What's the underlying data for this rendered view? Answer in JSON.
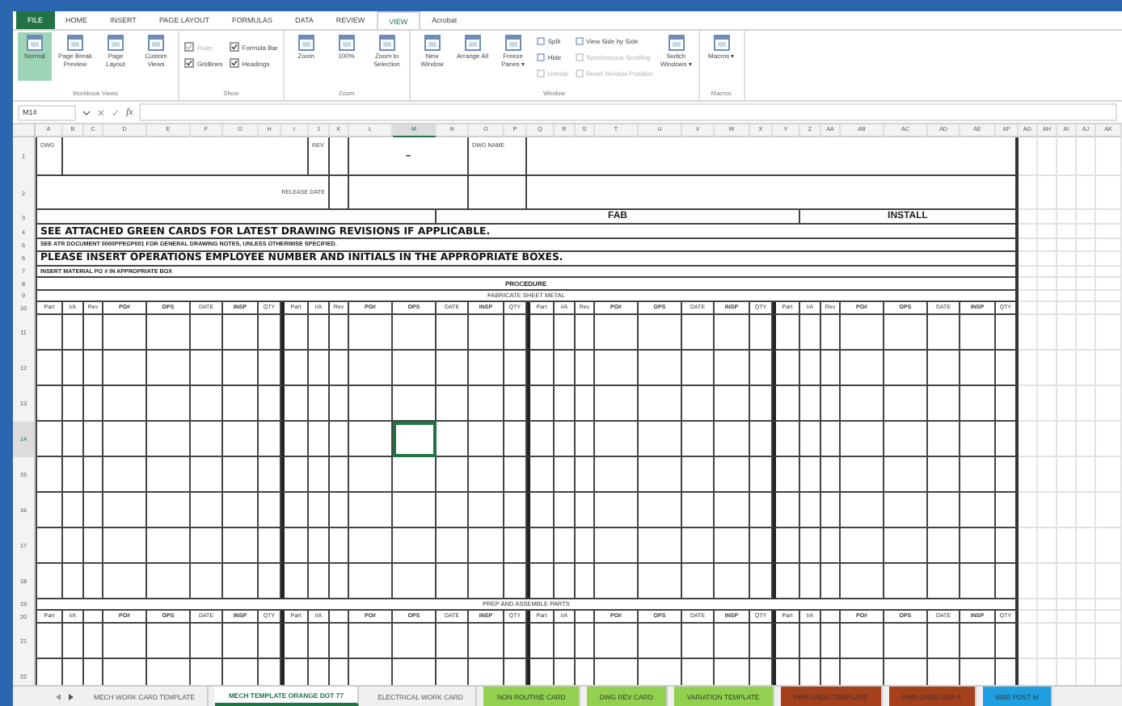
{
  "ribbon_tabs": [
    {
      "label": "FILE",
      "kind": "file",
      "selected": false
    },
    {
      "label": "HOME",
      "kind": "tab",
      "selected": false
    },
    {
      "label": "INSERT",
      "kind": "tab",
      "selected": false
    },
    {
      "label": "PAGE LAYOUT",
      "kind": "tab",
      "selected": false
    },
    {
      "label": "FORMULAS",
      "kind": "tab",
      "selected": false
    },
    {
      "label": "DATA",
      "kind": "tab",
      "selected": false
    },
    {
      "label": "REVIEW",
      "kind": "tab",
      "selected": false
    },
    {
      "label": "VIEW",
      "kind": "tab",
      "selected": true
    },
    {
      "label": "Acrobat",
      "kind": "tab",
      "selected": false
    }
  ],
  "ribbon_groups": [
    {
      "label": "Workbook Views",
      "items": [
        {
          "kind": "toggle",
          "label": "Normal",
          "selected": true
        },
        {
          "kind": "toggle",
          "label": "Page Break Preview",
          "selected": false
        },
        {
          "kind": "toggle",
          "label": "Page Layout",
          "selected": false
        },
        {
          "kind": "toggle",
          "label": "Custom Views",
          "selected": false
        }
      ]
    },
    {
      "label": "Show",
      "items": [
        {
          "kind": "check",
          "label": "Ruler",
          "checked": true,
          "disabled": true
        },
        {
          "kind": "check",
          "label": "Gridlines",
          "checked": true,
          "disabled": false
        },
        {
          "kind": "check",
          "label": "Formula Bar",
          "checked": true,
          "disabled": false
        },
        {
          "kind": "check",
          "label": "Headings",
          "checked": true,
          "disabled": false
        }
      ]
    },
    {
      "label": "Zoom",
      "items": [
        {
          "kind": "big",
          "label": "Zoom"
        },
        {
          "kind": "big",
          "label": "100%"
        },
        {
          "kind": "big",
          "label": "Zoom to Selection"
        }
      ]
    },
    {
      "label": "Window",
      "items": [
        {
          "kind": "big",
          "label": "New Window"
        },
        {
          "kind": "big",
          "label": "Arrange All"
        },
        {
          "kind": "big",
          "label": "Freeze Panes ▾"
        },
        {
          "kind": "small",
          "label": "Split",
          "disabled": false
        },
        {
          "kind": "small",
          "label": "Hide",
          "disabled": false
        },
        {
          "kind": "small",
          "label": "Unhide",
          "disabled": true
        },
        {
          "kind": "small",
          "label": "View Side by Side",
          "disabled": false
        },
        {
          "kind": "small",
          "label": "Synchronous Scrolling",
          "disabled": true
        },
        {
          "kind": "small",
          "label": "Reset Window Position",
          "disabled": true
        },
        {
          "kind": "big",
          "label": "Switch Windows ▾"
        }
      ]
    },
    {
      "label": "Macros",
      "items": [
        {
          "kind": "big",
          "label": "Macros ▾"
        }
      ]
    }
  ],
  "formula_bar": {
    "name_box": "M14",
    "cancel": "✕",
    "enter": "✓",
    "function": "fx"
  },
  "columns": [
    {
      "label": "A",
      "selected": false
    },
    {
      "label": "B",
      "selected": false
    },
    {
      "label": "C",
      "selected": false
    },
    {
      "label": "D",
      "selected": false
    },
    {
      "label": "E",
      "selected": false
    },
    {
      "label": "F",
      "selected": false
    },
    {
      "label": "G",
      "selected": false
    },
    {
      "label": "H",
      "selected": false
    },
    {
      "label": "I",
      "selected": false
    },
    {
      "label": "J",
      "selected": false
    },
    {
      "label": "K",
      "selected": false
    },
    {
      "label": "L",
      "selected": false
    },
    {
      "label": "M",
      "selected": true
    },
    {
      "label": "N",
      "selected": false
    },
    {
      "label": "O",
      "selected": false
    },
    {
      "label": "P",
      "selected": false
    },
    {
      "label": "Q",
      "selected": false
    },
    {
      "label": "R",
      "selected": false
    },
    {
      "label": "S",
      "selected": false
    },
    {
      "label": "T",
      "selected": false
    },
    {
      "label": "U",
      "selected": false
    },
    {
      "label": "V",
      "selected": false
    },
    {
      "label": "W",
      "selected": false
    },
    {
      "label": "X",
      "selected": false
    },
    {
      "label": "Y",
      "selected": false
    },
    {
      "label": "Z",
      "selected": false
    },
    {
      "label": "AA",
      "selected": false
    },
    {
      "label": "AB",
      "selected": false
    },
    {
      "label": "AC",
      "selected": false
    },
    {
      "label": "AD",
      "selected": false
    },
    {
      "label": "AE",
      "selected": false
    },
    {
      "label": "AF",
      "selected": false
    },
    {
      "label": "AG",
      "selected": false
    },
    {
      "label": "AH",
      "selected": false
    },
    {
      "label": "AI",
      "selected": false
    },
    {
      "label": "AJ",
      "selected": false
    },
    {
      "label": "AK",
      "selected": false
    }
  ],
  "rows": [
    {
      "kind": "title_top",
      "number": "1",
      "selected": false,
      "dwg_label": "DWG",
      "rev_label": "REV",
      "rev_value": "–",
      "dwg_name_label": "DWG NAME"
    },
    {
      "kind": "title_bottom",
      "number": "2",
      "selected": false,
      "release_date_label": "RELEASE DATE"
    },
    {
      "kind": "sections",
      "number": "3",
      "selected": false,
      "sections": [
        "FAB",
        "INSTALL"
      ]
    },
    {
      "kind": "note_large",
      "number": "4",
      "selected": false,
      "text": "SEE ATTACHED GREEN CARDS FOR LATEST DRAWING REVISIONS IF APPLICABLE."
    },
    {
      "kind": "note_small",
      "number": "5",
      "selected": false,
      "text": "SEE ATR DOCUMENT 0000PPEGP001 FOR GENERAL DRAWING NOTES, UNLESS OTHERWISE SPECIFIED."
    },
    {
      "kind": "note_large",
      "number": "6",
      "selected": false,
      "text": "PLEASE INSERT OPERATIONS EMPLOYEE NUMBER AND INITIALS IN THE APPROPRIATE BOXES."
    },
    {
      "kind": "note_small",
      "number": "7",
      "selected": false,
      "text": "INSERT MATERIAL PO # IN APPROPRIATE BOX"
    },
    {
      "kind": "heading",
      "number": "8",
      "selected": false,
      "text": "PROCEDURE"
    },
    {
      "kind": "subheading",
      "number": "9",
      "selected": false,
      "text": "FABRICATE SHEET METAL"
    },
    {
      "kind": "header",
      "number": "10",
      "selected": false,
      "cells": [
        "Part",
        "I/A",
        "Rev",
        "PO#",
        "OPS",
        "DATE",
        "INSP",
        "QTY",
        "Part",
        "I/A",
        "Rev",
        "PO#",
        "OPS",
        "DATE",
        "INSP",
        "QTY",
        "Part",
        "I/A",
        "Rev",
        "PO#",
        "OPS",
        "DATE",
        "INSP",
        "QTY",
        "Part",
        "I/A",
        "Rev",
        "PO#",
        "OPS",
        "DATE",
        "INSP",
        "QTY"
      ]
    },
    {
      "kind": "data",
      "number": "11",
      "selected": false
    },
    {
      "kind": "data",
      "number": "12",
      "selected": false
    },
    {
      "kind": "data",
      "number": "13",
      "selected": false
    },
    {
      "kind": "data",
      "number": "14",
      "selected": true
    },
    {
      "kind": "data",
      "number": "15",
      "selected": false
    },
    {
      "kind": "data",
      "number": "16",
      "selected": false
    },
    {
      "kind": "data",
      "number": "17",
      "selected": false
    },
    {
      "kind": "data",
      "number": "18",
      "selected": false
    },
    {
      "kind": "subheading",
      "number": "19",
      "selected": false,
      "text": "PREP AND ASSEMBLE PARTS"
    },
    {
      "kind": "header",
      "number": "20",
      "selected": false,
      "cells": [
        "Part",
        "I/A",
        "",
        "PO#",
        "OPS",
        "DATE",
        "INSP",
        "QTY",
        "Part",
        "I/A",
        "",
        "PO#",
        "OPS",
        "DATE",
        "INSP",
        "QTY",
        "Part",
        "I/A",
        "",
        "PO#",
        "OPS",
        "DATE",
        "INSP",
        "QTY",
        "Part",
        "I/A",
        "",
        "PO#",
        "OPS",
        "DATE",
        "INSP",
        "QTY"
      ]
    },
    {
      "kind": "data",
      "number": "21",
      "selected": false
    },
    {
      "kind": "data",
      "number": "22",
      "selected": false
    }
  ],
  "sheet_tabs": [
    {
      "label": "MECH WORK CARD TEMPLATE",
      "selected": false
    },
    {
      "label": "MECH TEMPLATE ORANGE DOT 77",
      "selected": true
    },
    {
      "label": "ELECTRICAL WORK CARD",
      "selected": false
    },
    {
      "label": "NON ROUTINE CARD",
      "selected": false,
      "color": "#92d050"
    },
    {
      "label": "DWG REV CARD",
      "selected": false,
      "color": "#92d050"
    },
    {
      "label": "VARIATION TEMPLATE",
      "selected": false,
      "color": "#92d050"
    },
    {
      "label": "PWR GNDS TEMPLATE",
      "selected": false,
      "color": "#a5401c"
    },
    {
      "label": "PWR GNDS GRP A",
      "selected": false,
      "color": "#a5401c"
    },
    {
      "label": "W&B POST M",
      "selected": false,
      "color": "#1f9fe0"
    }
  ]
}
